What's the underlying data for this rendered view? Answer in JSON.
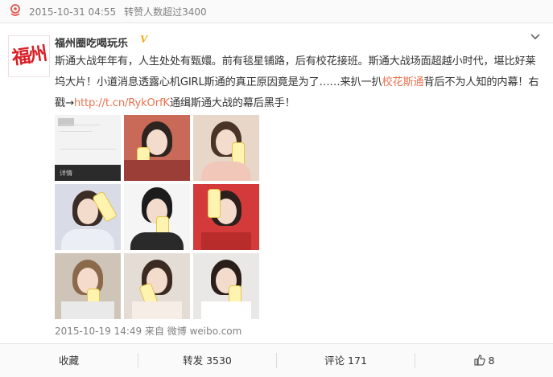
{
  "topbar": {
    "timestamp": "2015-10-31 04:55",
    "note": "转赞人数超过3400"
  },
  "post": {
    "avatar_text": "福州",
    "author": "福州圈吃喝玩乐",
    "verified_mark": "V",
    "text_part1": "斯通大战年年有，人生处处有甄嬛。前有毯星铺路，后有校花接班。斯通大战场面超越小时代，堪比好莱坞大片！小道消息透露心机GIRL斯通的真正原因竟是为了……来扒一扒",
    "hashtag": "校花斯通",
    "text_part2": "背后不为人知的内幕！右戳→",
    "link": "http://t.cn/RykOrfK",
    "text_part3": "通缉斯通大战的幕后黑手！",
    "footer_time": "2015-10-19 14:49",
    "footer_source": "来自 微博 weibo.com",
    "screenshot_label": "详情"
  },
  "actions": {
    "favorite": "收藏",
    "repost": "转发 3530",
    "comment": "评论 171",
    "like": "8"
  },
  "colors": {
    "accent": "#eb7350",
    "verified": "#f2a200",
    "avatar_red": "#d81f26",
    "muted": "#808080"
  }
}
